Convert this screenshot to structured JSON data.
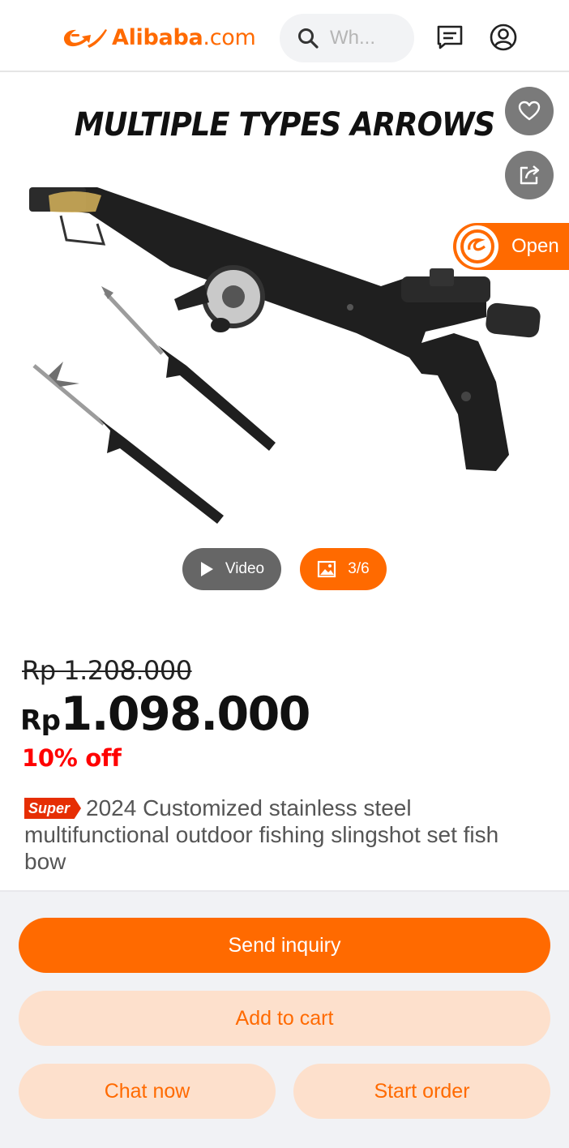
{
  "header": {
    "logo_text": "Alibaba",
    "logo_suffix": ".com",
    "search_placeholder": "Wh..."
  },
  "gallery": {
    "image_title": "MULTIPLE TYPES ARROWS",
    "open_label": "Open",
    "video_label": "Video",
    "image_counter": "3/6"
  },
  "product": {
    "original_price": "Rp 1.208.000",
    "price_currency": "Rp",
    "price_amount": "1.098.000",
    "discount": "10% off",
    "badge": "Super",
    "title": "2024 Customized stainless steel multifunctional outdoor fishing slingshot set fish bow"
  },
  "actions": {
    "send_inquiry": "Send inquiry",
    "add_to_cart": "Add to cart",
    "chat_now": "Chat now",
    "start_order": "Start order"
  },
  "colors": {
    "brand_orange": "#ff6a00",
    "discount_red": "#ff0000",
    "super_badge": "#e62e04",
    "secondary_button_bg": "#fde0cc"
  }
}
